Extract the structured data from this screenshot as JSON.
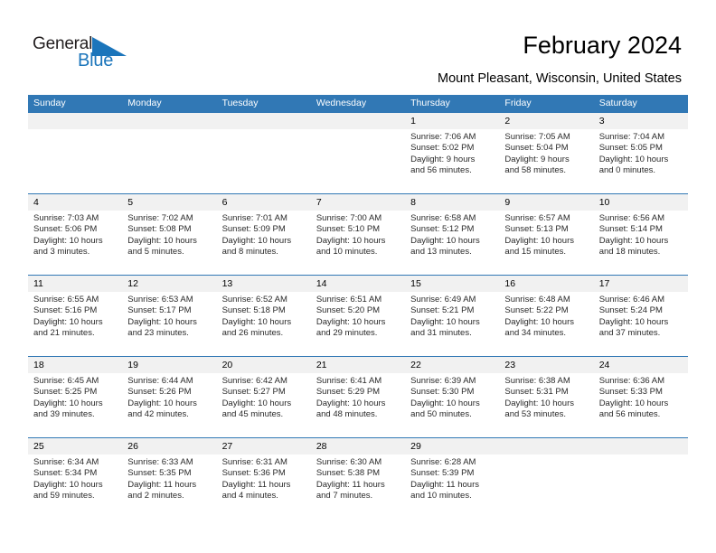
{
  "brand": {
    "name_part1": "General",
    "name_part2": "Blue",
    "triangle_icon": "triangle-icon",
    "accent_color": "#1b75bb"
  },
  "header": {
    "month_title": "February 2024",
    "location": "Mount Pleasant, Wisconsin, United States"
  },
  "theme": {
    "header_blue": "#3178b5",
    "date_band_gray": "#f1f1f1",
    "text_color": "#000000"
  },
  "weekdays": [
    "Sunday",
    "Monday",
    "Tuesday",
    "Wednesday",
    "Thursday",
    "Friday",
    "Saturday"
  ],
  "weeks": [
    [
      {
        "day": "",
        "sunrise": "",
        "sunset": "",
        "daylight_line1": "",
        "daylight_line2": "",
        "empty": true
      },
      {
        "day": "",
        "sunrise": "",
        "sunset": "",
        "daylight_line1": "",
        "daylight_line2": "",
        "empty": true
      },
      {
        "day": "",
        "sunrise": "",
        "sunset": "",
        "daylight_line1": "",
        "daylight_line2": "",
        "empty": true
      },
      {
        "day": "",
        "sunrise": "",
        "sunset": "",
        "daylight_line1": "",
        "daylight_line2": "",
        "empty": true
      },
      {
        "day": "1",
        "sunrise": "Sunrise: 7:06 AM",
        "sunset": "Sunset: 5:02 PM",
        "daylight_line1": "Daylight: 9 hours",
        "daylight_line2": "and 56 minutes."
      },
      {
        "day": "2",
        "sunrise": "Sunrise: 7:05 AM",
        "sunset": "Sunset: 5:04 PM",
        "daylight_line1": "Daylight: 9 hours",
        "daylight_line2": "and 58 minutes."
      },
      {
        "day": "3",
        "sunrise": "Sunrise: 7:04 AM",
        "sunset": "Sunset: 5:05 PM",
        "daylight_line1": "Daylight: 10 hours",
        "daylight_line2": "and 0 minutes."
      }
    ],
    [
      {
        "day": "4",
        "sunrise": "Sunrise: 7:03 AM",
        "sunset": "Sunset: 5:06 PM",
        "daylight_line1": "Daylight: 10 hours",
        "daylight_line2": "and 3 minutes."
      },
      {
        "day": "5",
        "sunrise": "Sunrise: 7:02 AM",
        "sunset": "Sunset: 5:08 PM",
        "daylight_line1": "Daylight: 10 hours",
        "daylight_line2": "and 5 minutes."
      },
      {
        "day": "6",
        "sunrise": "Sunrise: 7:01 AM",
        "sunset": "Sunset: 5:09 PM",
        "daylight_line1": "Daylight: 10 hours",
        "daylight_line2": "and 8 minutes."
      },
      {
        "day": "7",
        "sunrise": "Sunrise: 7:00 AM",
        "sunset": "Sunset: 5:10 PM",
        "daylight_line1": "Daylight: 10 hours",
        "daylight_line2": "and 10 minutes."
      },
      {
        "day": "8",
        "sunrise": "Sunrise: 6:58 AM",
        "sunset": "Sunset: 5:12 PM",
        "daylight_line1": "Daylight: 10 hours",
        "daylight_line2": "and 13 minutes."
      },
      {
        "day": "9",
        "sunrise": "Sunrise: 6:57 AM",
        "sunset": "Sunset: 5:13 PM",
        "daylight_line1": "Daylight: 10 hours",
        "daylight_line2": "and 15 minutes."
      },
      {
        "day": "10",
        "sunrise": "Sunrise: 6:56 AM",
        "sunset": "Sunset: 5:14 PM",
        "daylight_line1": "Daylight: 10 hours",
        "daylight_line2": "and 18 minutes."
      }
    ],
    [
      {
        "day": "11",
        "sunrise": "Sunrise: 6:55 AM",
        "sunset": "Sunset: 5:16 PM",
        "daylight_line1": "Daylight: 10 hours",
        "daylight_line2": "and 21 minutes."
      },
      {
        "day": "12",
        "sunrise": "Sunrise: 6:53 AM",
        "sunset": "Sunset: 5:17 PM",
        "daylight_line1": "Daylight: 10 hours",
        "daylight_line2": "and 23 minutes."
      },
      {
        "day": "13",
        "sunrise": "Sunrise: 6:52 AM",
        "sunset": "Sunset: 5:18 PM",
        "daylight_line1": "Daylight: 10 hours",
        "daylight_line2": "and 26 minutes."
      },
      {
        "day": "14",
        "sunrise": "Sunrise: 6:51 AM",
        "sunset": "Sunset: 5:20 PM",
        "daylight_line1": "Daylight: 10 hours",
        "daylight_line2": "and 29 minutes."
      },
      {
        "day": "15",
        "sunrise": "Sunrise: 6:49 AM",
        "sunset": "Sunset: 5:21 PM",
        "daylight_line1": "Daylight: 10 hours",
        "daylight_line2": "and 31 minutes."
      },
      {
        "day": "16",
        "sunrise": "Sunrise: 6:48 AM",
        "sunset": "Sunset: 5:22 PM",
        "daylight_line1": "Daylight: 10 hours",
        "daylight_line2": "and 34 minutes."
      },
      {
        "day": "17",
        "sunrise": "Sunrise: 6:46 AM",
        "sunset": "Sunset: 5:24 PM",
        "daylight_line1": "Daylight: 10 hours",
        "daylight_line2": "and 37 minutes."
      }
    ],
    [
      {
        "day": "18",
        "sunrise": "Sunrise: 6:45 AM",
        "sunset": "Sunset: 5:25 PM",
        "daylight_line1": "Daylight: 10 hours",
        "daylight_line2": "and 39 minutes."
      },
      {
        "day": "19",
        "sunrise": "Sunrise: 6:44 AM",
        "sunset": "Sunset: 5:26 PM",
        "daylight_line1": "Daylight: 10 hours",
        "daylight_line2": "and 42 minutes."
      },
      {
        "day": "20",
        "sunrise": "Sunrise: 6:42 AM",
        "sunset": "Sunset: 5:27 PM",
        "daylight_line1": "Daylight: 10 hours",
        "daylight_line2": "and 45 minutes."
      },
      {
        "day": "21",
        "sunrise": "Sunrise: 6:41 AM",
        "sunset": "Sunset: 5:29 PM",
        "daylight_line1": "Daylight: 10 hours",
        "daylight_line2": "and 48 minutes."
      },
      {
        "day": "22",
        "sunrise": "Sunrise: 6:39 AM",
        "sunset": "Sunset: 5:30 PM",
        "daylight_line1": "Daylight: 10 hours",
        "daylight_line2": "and 50 minutes."
      },
      {
        "day": "23",
        "sunrise": "Sunrise: 6:38 AM",
        "sunset": "Sunset: 5:31 PM",
        "daylight_line1": "Daylight: 10 hours",
        "daylight_line2": "and 53 minutes."
      },
      {
        "day": "24",
        "sunrise": "Sunrise: 6:36 AM",
        "sunset": "Sunset: 5:33 PM",
        "daylight_line1": "Daylight: 10 hours",
        "daylight_line2": "and 56 minutes."
      }
    ],
    [
      {
        "day": "25",
        "sunrise": "Sunrise: 6:34 AM",
        "sunset": "Sunset: 5:34 PM",
        "daylight_line1": "Daylight: 10 hours",
        "daylight_line2": "and 59 minutes."
      },
      {
        "day": "26",
        "sunrise": "Sunrise: 6:33 AM",
        "sunset": "Sunset: 5:35 PM",
        "daylight_line1": "Daylight: 11 hours",
        "daylight_line2": "and 2 minutes."
      },
      {
        "day": "27",
        "sunrise": "Sunrise: 6:31 AM",
        "sunset": "Sunset: 5:36 PM",
        "daylight_line1": "Daylight: 11 hours",
        "daylight_line2": "and 4 minutes."
      },
      {
        "day": "28",
        "sunrise": "Sunrise: 6:30 AM",
        "sunset": "Sunset: 5:38 PM",
        "daylight_line1": "Daylight: 11 hours",
        "daylight_line2": "and 7 minutes."
      },
      {
        "day": "29",
        "sunrise": "Sunrise: 6:28 AM",
        "sunset": "Sunset: 5:39 PM",
        "daylight_line1": "Daylight: 11 hours",
        "daylight_line2": "and 10 minutes."
      },
      {
        "day": "",
        "sunrise": "",
        "sunset": "",
        "daylight_line1": "",
        "daylight_line2": "",
        "empty": true
      },
      {
        "day": "",
        "sunrise": "",
        "sunset": "",
        "daylight_line1": "",
        "daylight_line2": "",
        "empty": true
      }
    ]
  ]
}
